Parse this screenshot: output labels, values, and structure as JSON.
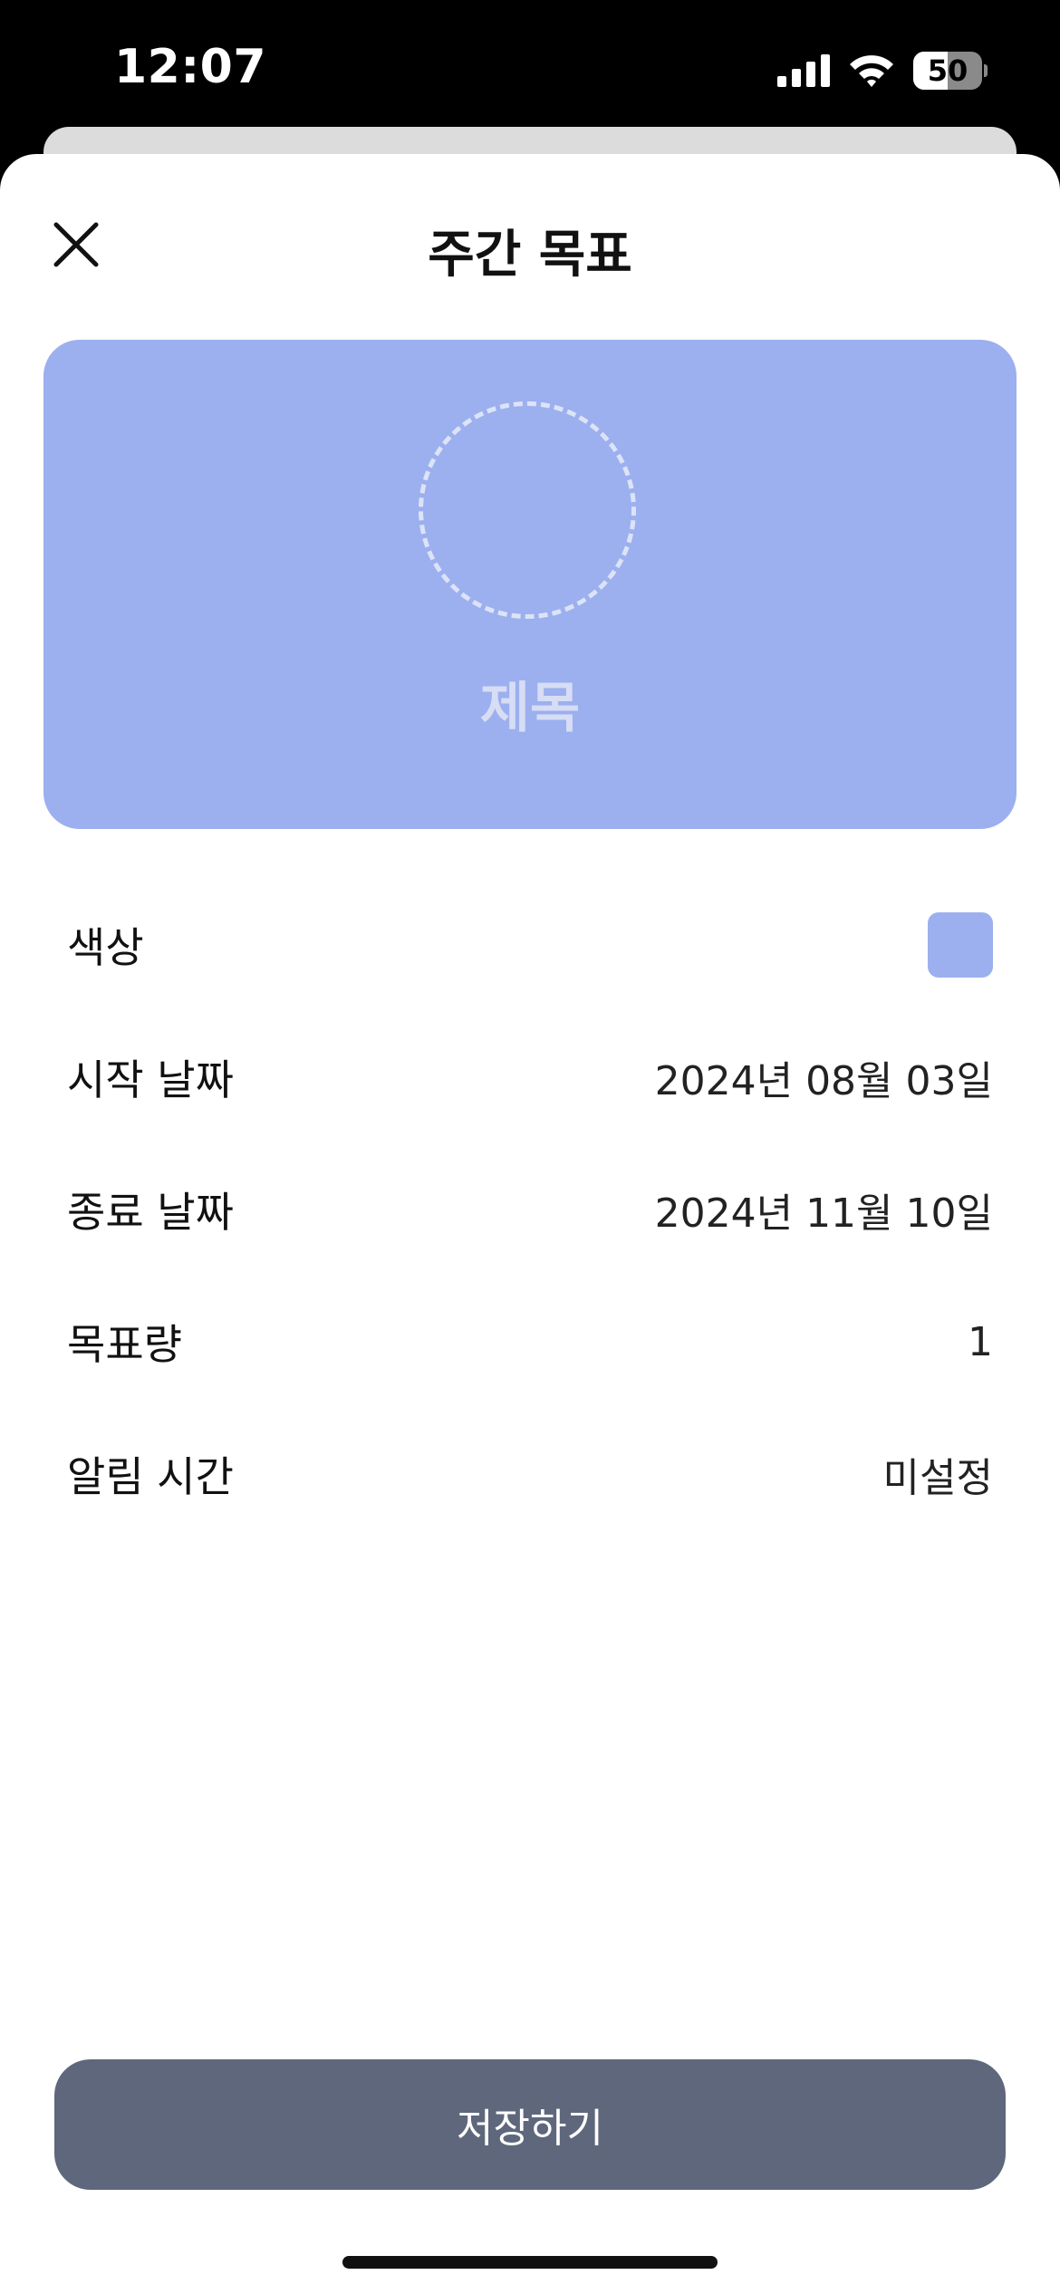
{
  "status_bar": {
    "time": "12:07",
    "battery_level": "50",
    "battery_fraction": 0.5,
    "icons": [
      "cellular-signal-icon",
      "wifi-icon",
      "battery-icon"
    ]
  },
  "header": {
    "title": "주간 목표",
    "close_icon": "close-icon"
  },
  "preview": {
    "title_placeholder": "제목",
    "icon_placeholder": "dashed-circle-icon",
    "background_color": "#9cb0ef"
  },
  "settings": {
    "color": {
      "label": "색상",
      "value_color": "#9cb0ef"
    },
    "start_date": {
      "label": "시작 날짜",
      "value": "2024년 08월 03일"
    },
    "end_date": {
      "label": "종료 날짜",
      "value": "2024년 11월 10일"
    },
    "target_amount": {
      "label": "목표량",
      "value": "1"
    },
    "alarm_time": {
      "label": "알림 시간",
      "value": "미설정"
    }
  },
  "footer": {
    "save_label": "저장하기",
    "save_color": "#5f677c"
  }
}
